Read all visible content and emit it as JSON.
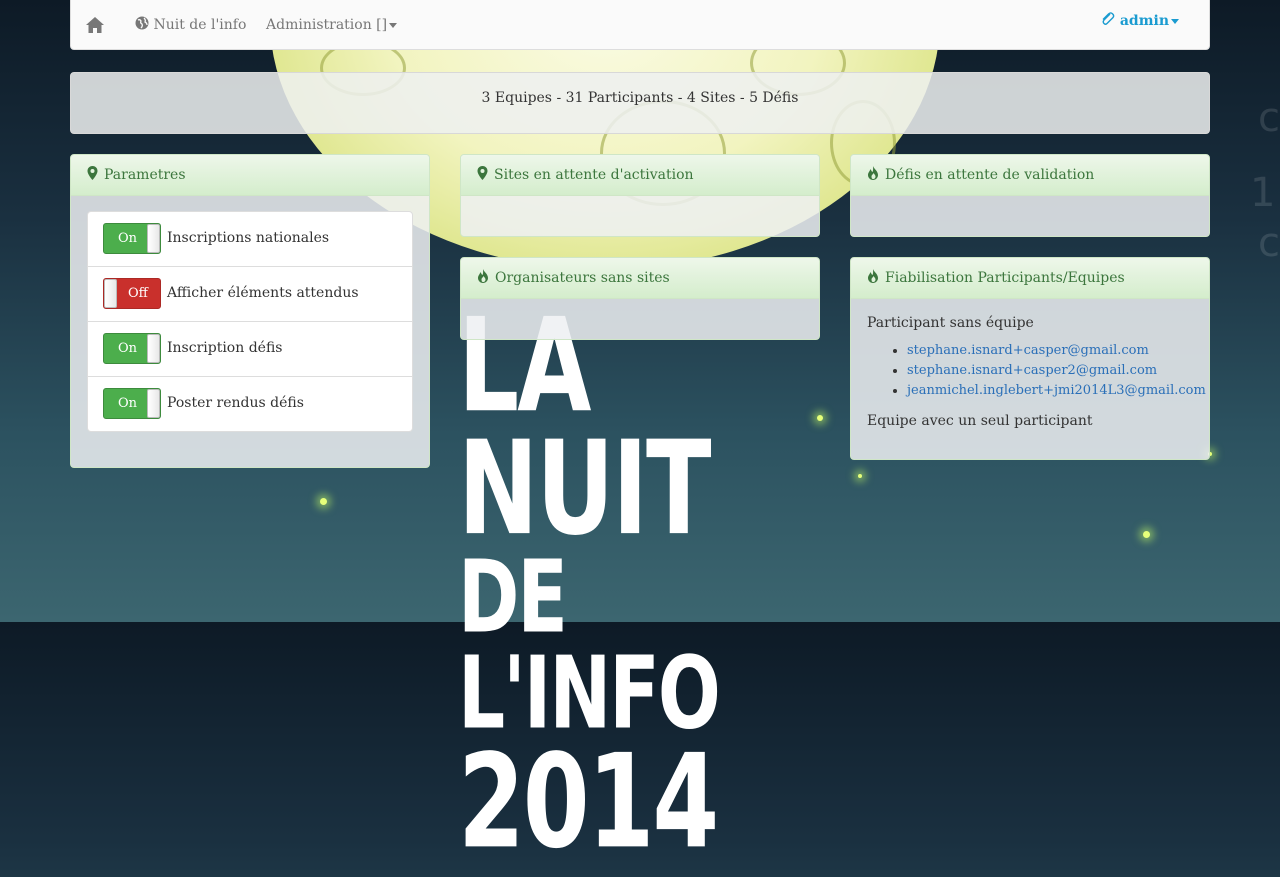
{
  "navbar": {
    "brand": "Nuit de l'info",
    "admin_menu": "Administration []",
    "user": "admin"
  },
  "stats": "3 Equipes - 31 Participants - 4 Sites - 5 Défis",
  "panels": {
    "parametres": {
      "title": "Parametres",
      "items": [
        {
          "state": "On",
          "label": "Inscriptions nationales"
        },
        {
          "state": "Off",
          "label": "Afficher éléments attendus"
        },
        {
          "state": "On",
          "label": "Inscription défis"
        },
        {
          "state": "On",
          "label": "Poster rendus défis"
        }
      ]
    },
    "sites": {
      "title": "Sites en attente d'activation"
    },
    "organisateurs": {
      "title": "Organisateurs sans sites"
    },
    "defis": {
      "title": "Défis en attente de validation"
    },
    "fiabilisation": {
      "title": "Fiabilisation Participants/Equipes",
      "section1": "Participant sans équipe",
      "emails": [
        "stephane.isnard+casper@gmail.com",
        "stephane.isnard+casper2@gmail.com",
        "jeanmichel.inglebert+jmi2014L3@gmail.com"
      ],
      "section2": "Equipe avec un seul participant"
    }
  },
  "logo": {
    "line1": "LA NUIT",
    "line2": "DE L'INFO",
    "line3": "2014"
  },
  "colors": {
    "accent": "#1a9bd0",
    "switch_on": "#4cae4c",
    "switch_off": "#c9302c",
    "panel_heading": "#3c763d"
  }
}
